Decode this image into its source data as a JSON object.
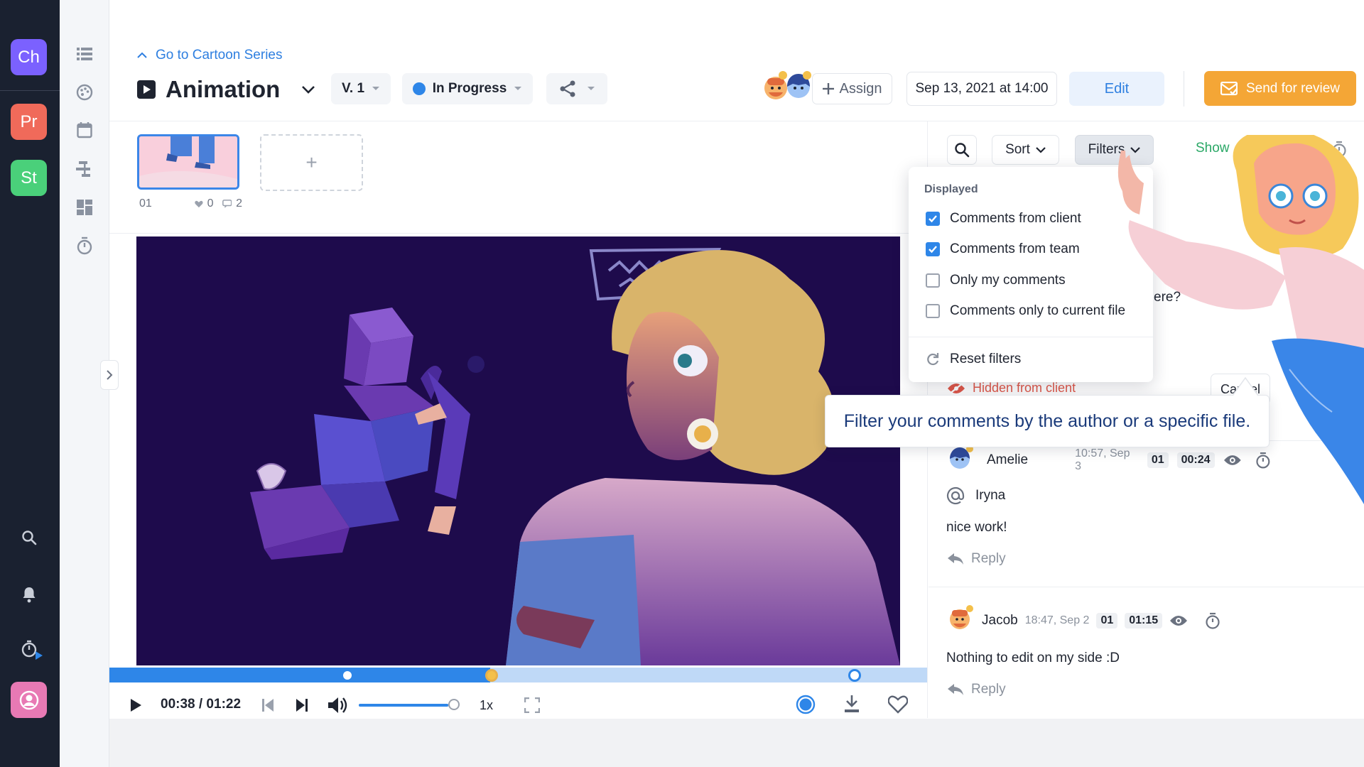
{
  "workspaces": [
    {
      "label": "Ch",
      "color": "#7b61ff"
    },
    {
      "label": "Pr",
      "color": "#f06a5a"
    },
    {
      "label": "St",
      "color": "#4ad07a"
    }
  ],
  "rail_icons": [
    "search-icon",
    "bell-icon",
    "timer-play-icon",
    "user-icon"
  ],
  "tool_icons": [
    "list-icon",
    "palette-icon",
    "calendar-icon",
    "gantt-icon",
    "dashboard-icon",
    "stopwatch-icon"
  ],
  "header": {
    "breadcrumb": "Go to Cartoon Series",
    "title": "Animation",
    "version": "V. 1",
    "status": "In Progress",
    "status_color": "#2e86e8",
    "assign_label": "Assign",
    "date": "Sep 13, 2021 at 14:00",
    "edit_label": "Edit",
    "review_label": "Send for review",
    "accent": "#f4a636"
  },
  "thumbnail": {
    "number": "01",
    "likes": "0",
    "comments": "2",
    "add_label": "+"
  },
  "player": {
    "time": "00:38 / 01:22",
    "speed": "1x",
    "progress_fraction": 0.465,
    "volume_fraction": 0.9
  },
  "panel": {
    "sort_label": "Sort",
    "filters_label": "Filters",
    "show_label": "Show"
  },
  "filter_menu": {
    "section": "Displayed",
    "options": [
      {
        "label": "Comments from client",
        "checked": true
      },
      {
        "label": "Comments from team",
        "checked": true
      },
      {
        "label": "Only my comments",
        "checked": false
      },
      {
        "label": "Comments only to current file",
        "checked": false
      }
    ],
    "reset_label": "Reset filters"
  },
  "partial": {
    "hidden_label": "Hidden from client",
    "cancel_label": "Cancel",
    "ere_fragment": "ere?"
  },
  "tooltip": "Filter your comments by the author or a specific file.",
  "comments": [
    {
      "author": "Amelie",
      "time": "10:57, Sep 3",
      "file": "01",
      "stamp": "00:24",
      "mention": "Iryna",
      "text": "nice work!",
      "reply": "Reply"
    },
    {
      "author": "Jacob",
      "time": "18:47, Sep 2",
      "file": "01",
      "stamp": "01:15",
      "mention": "",
      "text": "Nothing to edit on my side :D",
      "reply": "Reply"
    }
  ]
}
